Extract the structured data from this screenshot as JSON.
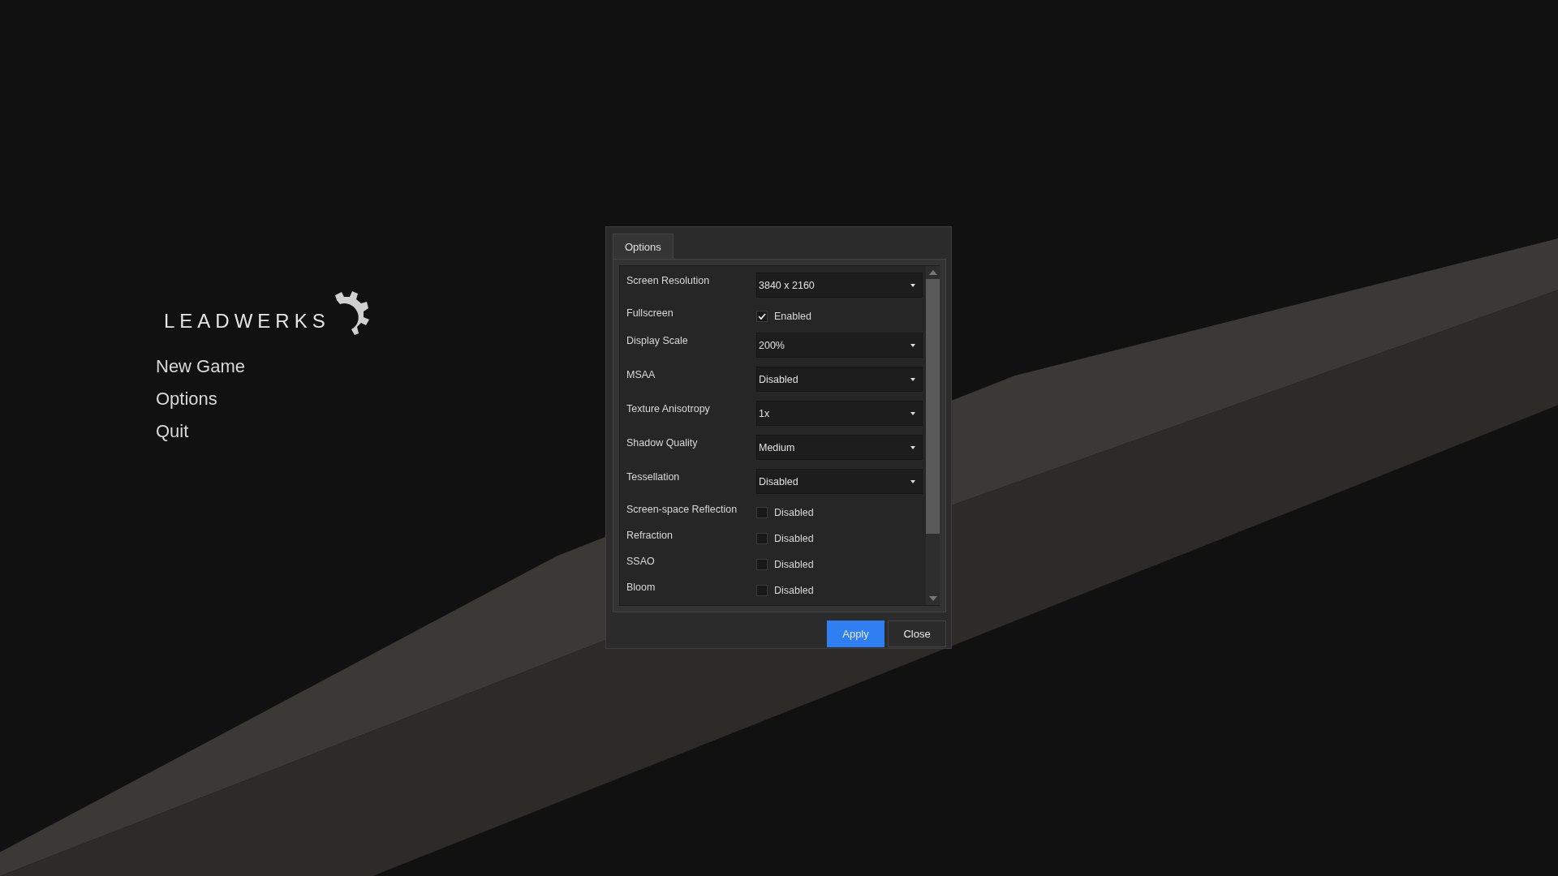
{
  "menu": {
    "logo": "LEADWERKS",
    "items": [
      "New Game",
      "Options",
      "Quit"
    ]
  },
  "dialog": {
    "tabs": [
      {
        "label": "Options",
        "selected": true
      }
    ],
    "settings": [
      {
        "kind": "dropdown",
        "label": "Screen Resolution",
        "value": "3840 x 2160"
      },
      {
        "kind": "checkbox",
        "label": "Fullscreen",
        "checked": true,
        "value": "Enabled"
      },
      {
        "kind": "dropdown",
        "label": "Display Scale",
        "value": "200%"
      },
      {
        "kind": "dropdown",
        "label": "MSAA",
        "value": "Disabled"
      },
      {
        "kind": "dropdown",
        "label": "Texture Anisotropy",
        "value": "1x"
      },
      {
        "kind": "dropdown",
        "label": "Shadow Quality",
        "value": "Medium"
      },
      {
        "kind": "dropdown",
        "label": "Tessellation",
        "value": "Disabled"
      },
      {
        "kind": "checkbox",
        "label": "Screen-space Reflection",
        "checked": false,
        "value": "Disabled"
      },
      {
        "kind": "checkbox",
        "label": "Refraction",
        "checked": false,
        "value": "Disabled"
      },
      {
        "kind": "checkbox",
        "label": "SSAO",
        "checked": false,
        "value": "Disabled"
      },
      {
        "kind": "checkbox",
        "label": "Bloom",
        "checked": false,
        "value": "Disabled"
      }
    ],
    "buttons": [
      {
        "label": "Apply",
        "primary": true
      },
      {
        "label": "Close",
        "primary": false
      }
    ]
  }
}
